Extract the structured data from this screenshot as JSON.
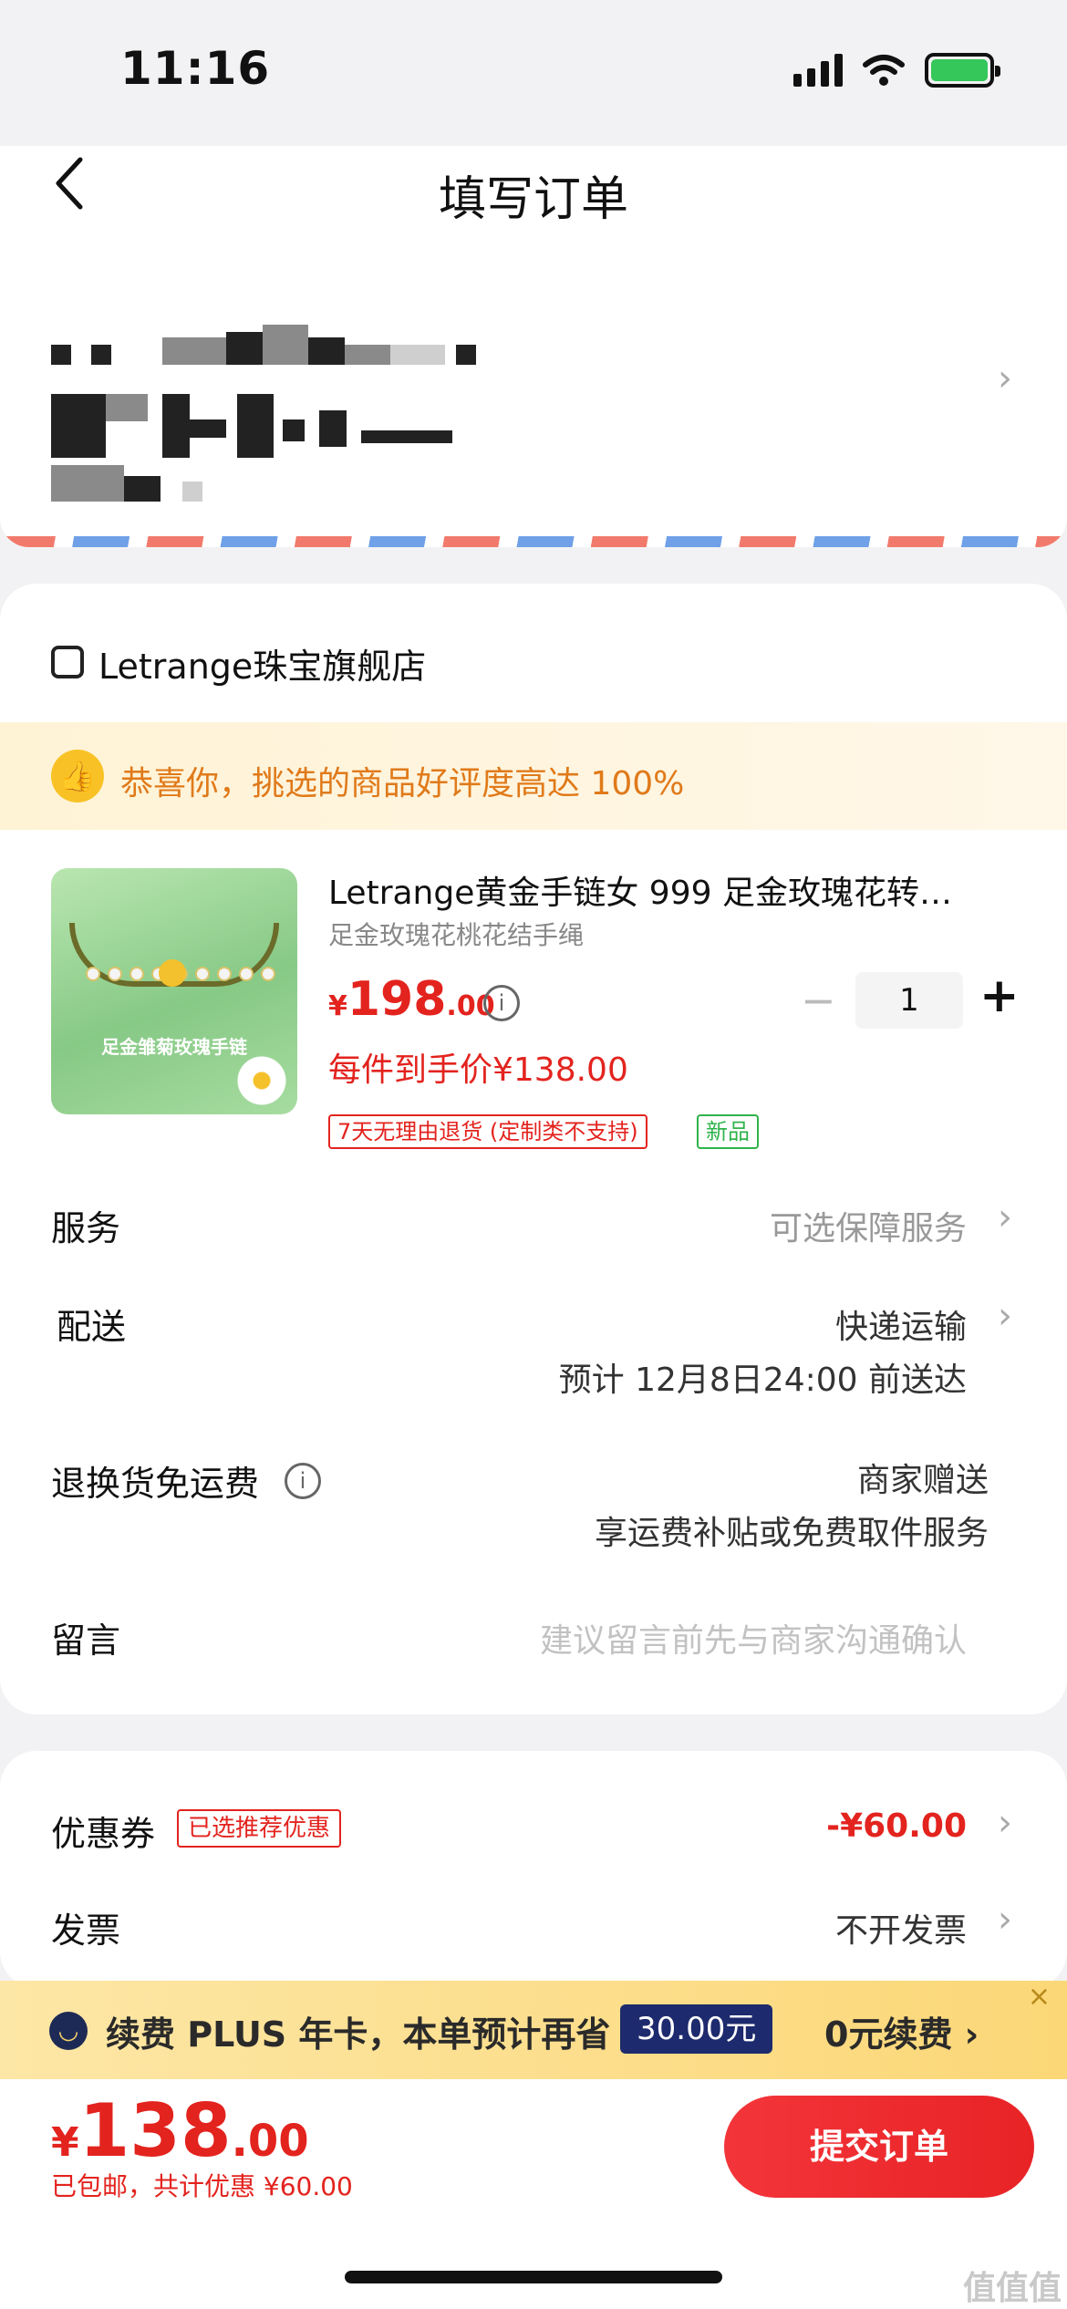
{
  "status_bar": {
    "time": "11:16"
  },
  "header": {
    "title": "填写订单",
    "back_icon": "chevron-left-icon"
  },
  "store": {
    "name": "Letrange珠宝旗舰店",
    "icon": "store-icon"
  },
  "banner": {
    "text": "恭喜你，挑选的商品好评度高达 100%",
    "icon": "thumbs-up-icon"
  },
  "product": {
    "title": "Letrange黄金手链女 999 足金玫瑰花转…",
    "sku": "足金玫瑰花桃花结手绳",
    "image_caption": "足金雏菊玫瑰手链",
    "price_symbol": "¥",
    "price_int": "198",
    "price_dec": ".00",
    "quantity": "1",
    "qty_minus": "−",
    "qty_plus": "+",
    "unit_price": "每件到手价¥138.00",
    "tag_return": "7天无理由退货 (定制类不支持)",
    "tag_new": "新品"
  },
  "rows": {
    "service_label": "服务",
    "service_value": "可选保障服务",
    "delivery_label": "配送",
    "delivery_value": "快递运输",
    "delivery_eta": "预计 12月8日24:00 前送达",
    "return_label": "退换货免运费",
    "return_value": "商家赠送",
    "return_desc": "享运费补贴或免费取件服务",
    "message_label": "留言",
    "message_placeholder": "建议留言前先与商家沟通确认"
  },
  "discounts": {
    "coupon_label": "优惠券",
    "coupon_tag": "已选推荐优惠",
    "coupon_value": "-¥60.00",
    "invoice_label": "发票",
    "invoice_value": "不开发票"
  },
  "plus_bar": {
    "text": "续费 PLUS 年卡，本单预计再省",
    "amount": "30.00元",
    "cta": "0元续费 ›",
    "close": "×"
  },
  "footer": {
    "total_symbol": "¥",
    "total_int": "138",
    "total_dec": ".00",
    "note": "已包邮，共计优惠 ¥60.00",
    "submit_label": "提交订单"
  },
  "watermark": "值值值",
  "colors": {
    "accent": "#e3231e",
    "banner_text": "#e07a1a",
    "plus_chip": "#1d2a6d"
  }
}
